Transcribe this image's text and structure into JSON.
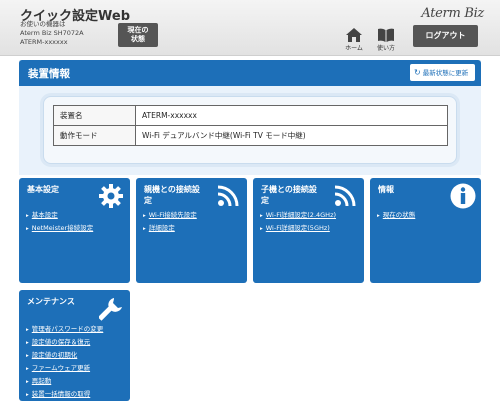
{
  "header": {
    "app_title": "クイック設定Web",
    "device_label": "お使いの機器は",
    "device_model": "Aterm Biz SH7072A",
    "device_name": "ATERM-xxxxxx",
    "status_button": [
      "現在の",
      "状態"
    ],
    "brand": "Aterm Biz",
    "home_label": "ホーム",
    "howto_label": "使い方",
    "logout_label": "ログアウト"
  },
  "device_info": {
    "title": "装置情報",
    "refresh_label": "最新状態に更新",
    "rows": [
      {
        "key": "装置名",
        "value": "ATERM-xxxxxx"
      },
      {
        "key": "動作モード",
        "value": "Wi-Fi デュアルバンド中継(Wi-Fi TV モード中継)"
      }
    ]
  },
  "tiles": [
    {
      "title": [
        "基本設定"
      ],
      "icon": "gear-icon",
      "links": [
        "基本設定",
        "NetMeister接続設定"
      ]
    },
    {
      "title": [
        "親機との接続設",
        "定"
      ],
      "icon": "wifi-icon",
      "links": [
        "Wi-Fi接続先設定",
        "詳細設定"
      ]
    },
    {
      "title": [
        "子機との接続設",
        "定"
      ],
      "icon": "wifi-icon",
      "links": [
        "Wi-Fi詳細設定(2.4GHz)",
        "Wi-Fi詳細設定(5GHz)"
      ]
    },
    {
      "title": [
        "情報"
      ],
      "icon": "info-icon",
      "links": [
        "現在の状態"
      ]
    },
    {
      "title": [
        "メンテナンス"
      ],
      "icon": "wrench-icon",
      "links": [
        "管理者パスワードの変更",
        "設定値の保存＆復元",
        "設定値の初期化",
        "ファームウェア更新",
        "再起動",
        "装置一括情報の取得"
      ]
    }
  ],
  "colors": {
    "accent": "#1d6fb8",
    "panel_bg": "#e9f2fb",
    "header_button": "#555555"
  }
}
